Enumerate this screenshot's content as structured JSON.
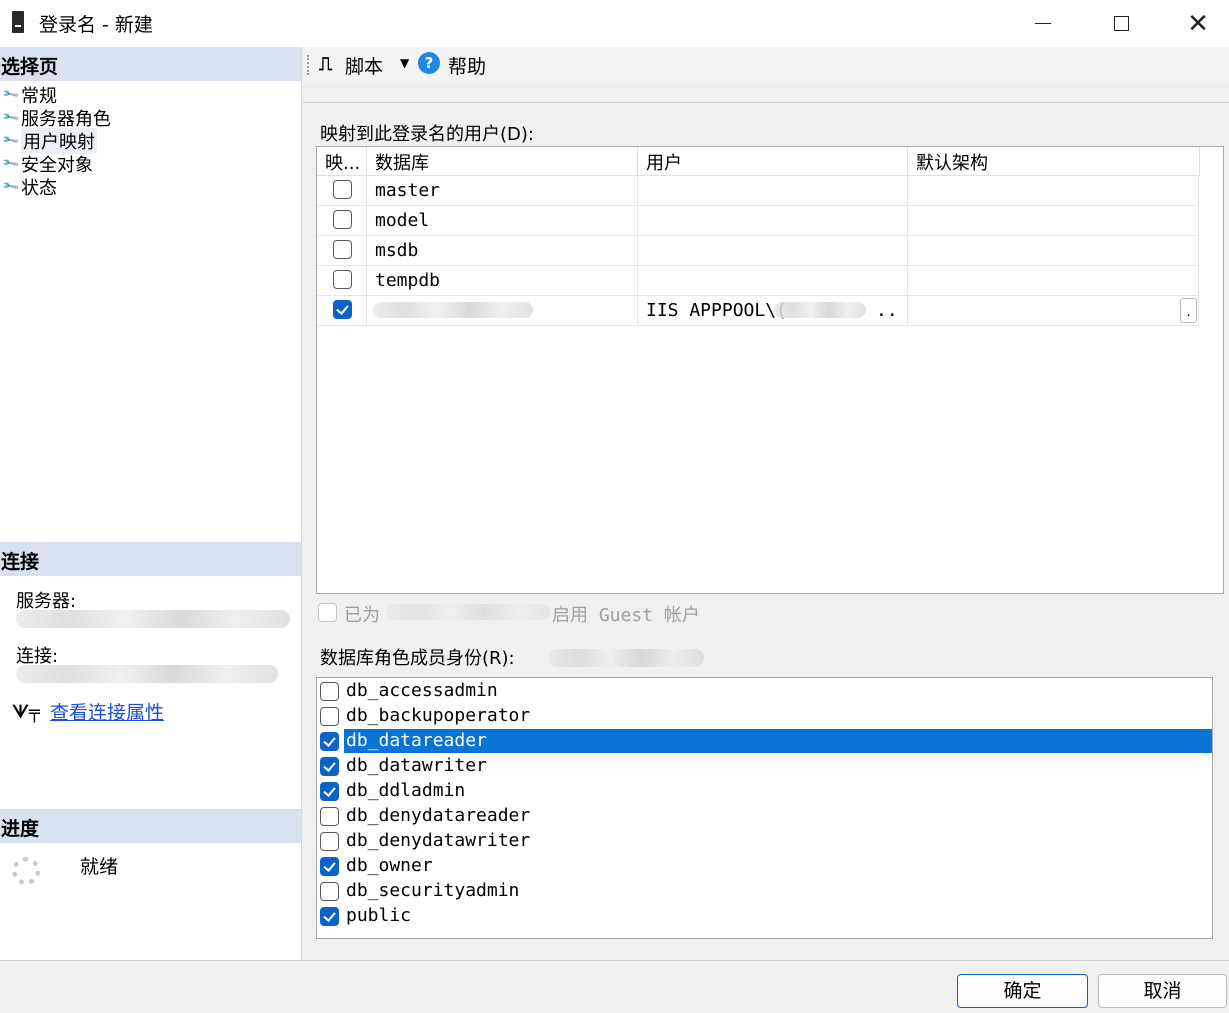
{
  "window": {
    "title": "登录名 - 新建"
  },
  "sidebar": {
    "select_page_header": "选择页",
    "items": [
      {
        "label": "常规"
      },
      {
        "label": "服务器角色"
      },
      {
        "label": "用户映射",
        "selected": true
      },
      {
        "label": "安全对象"
      },
      {
        "label": "状态"
      }
    ],
    "connection_header": "连接",
    "server_label": "服务器:",
    "connection_label": "连接:",
    "view_props_link": "查看连接属性",
    "progress_header": "进度",
    "progress_status": "就绪"
  },
  "toolbar": {
    "script_label": "脚本",
    "help_label": "帮助"
  },
  "mapping": {
    "label": "映射到此登录名的用户(D):",
    "columns": [
      "映...",
      "数据库",
      "用户",
      "默认架构"
    ],
    "rows": [
      {
        "mapped": false,
        "database": "master",
        "user": "",
        "schema": ""
      },
      {
        "mapped": false,
        "database": "model",
        "user": "",
        "schema": ""
      },
      {
        "mapped": false,
        "database": "msdb",
        "user": "",
        "schema": ""
      },
      {
        "mapped": false,
        "database": "tempdb",
        "user": "",
        "schema": ""
      },
      {
        "mapped": true,
        "database": "",
        "user": "IIS APPPOOL\\(",
        "user_suffix": "..",
        "schema": "",
        "schema_button": "."
      }
    ]
  },
  "guest": {
    "prefix": "已为",
    "suffix": "启用 Guest 帐户",
    "checked": false,
    "enabled": false
  },
  "roles": {
    "label": "数据库角色成员身份(R):",
    "items": [
      {
        "name": "db_accessadmin",
        "checked": false
      },
      {
        "name": "db_backupoperator",
        "checked": false
      },
      {
        "name": "db_datareader",
        "checked": true,
        "selected": true
      },
      {
        "name": "db_datawriter",
        "checked": true
      },
      {
        "name": "db_ddladmin",
        "checked": true
      },
      {
        "name": "db_denydatareader",
        "checked": false
      },
      {
        "name": "db_denydatawriter",
        "checked": false
      },
      {
        "name": "db_owner",
        "checked": true
      },
      {
        "name": "db_securityadmin",
        "checked": false
      },
      {
        "name": "public",
        "checked": true
      }
    ]
  },
  "buttons": {
    "ok": "确定",
    "cancel": "取消"
  },
  "colors": {
    "accent": "#0b63c9",
    "selection": "#0a74d6",
    "section_header": "#d7e2ee",
    "link": "#1b4fd6"
  }
}
